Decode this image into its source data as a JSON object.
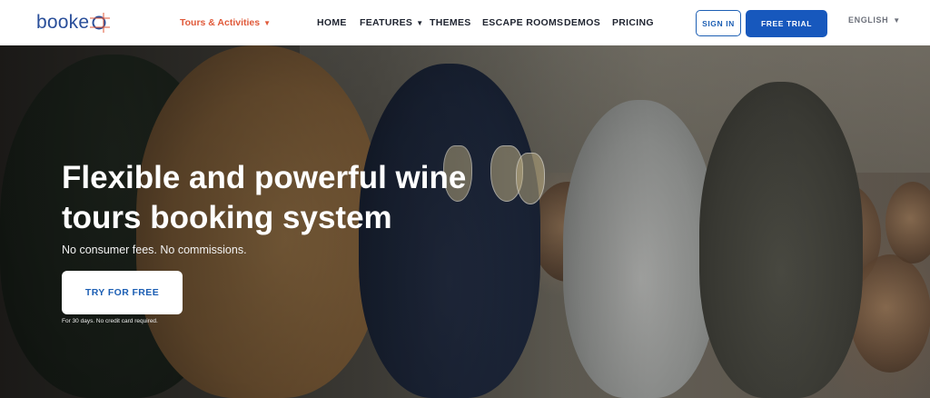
{
  "brand": {
    "logo_text": "booke",
    "accent": "#e05a3a",
    "primary": "#1758bd"
  },
  "nav": {
    "tours": "Tours & Activities",
    "items": [
      "HOME",
      "FEATURES",
      "THEMES",
      "ESCAPE ROOMS",
      "DEMOS",
      "PRICING"
    ],
    "sign_in": "SIGN IN",
    "free_trial": "FREE TRIAL",
    "language": "ENGLISH",
    "icons": [
      "chevron-down-icon"
    ]
  },
  "hero": {
    "headline_line1": "Flexible and powerful wine",
    "headline_line2": "tours booking system",
    "subtitle": "No consumer fees. No commissions.",
    "cta": "TRY FOR FREE",
    "fineprint": "For 30 days. No credit card required.",
    "image": "people-toasting-wine-glasses-in-cellar"
  }
}
